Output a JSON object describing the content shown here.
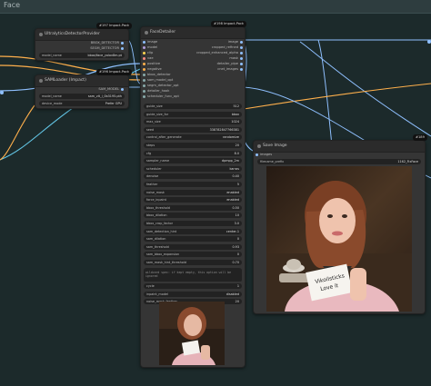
{
  "group": {
    "title": "Face"
  },
  "nodes": {
    "ultralytics": {
      "title": "UltralyticsDetectorProvider",
      "badge": "#197 Impact-Pack",
      "outputs": [
        "BBOX_DETECTOR",
        "SEGM_DETECTOR"
      ],
      "model_name_label": "model_name",
      "model_name_value": "bbox/face_yolov8m.pt"
    },
    "samloader": {
      "title": "SAMLoader (Impact)",
      "badge": "#196 Impact-Pack",
      "output": "SAM_MODEL",
      "widgets": [
        {
          "label": "model_name",
          "value": "sam_vit_l_0b3195.pth"
        },
        {
          "label": "device_mode",
          "value": "Prefer GPU"
        }
      ]
    },
    "facedetailer": {
      "title": "FaceDetailer",
      "badge": "#198 Impact-Pack",
      "inputs": [
        "image",
        "model",
        "clip",
        "vae",
        "positive",
        "negative",
        "bbox_detector",
        "sam_model_opt",
        "segm_detector_opt",
        "detailer_hook",
        "scheduler_func_opt"
      ],
      "outputs": [
        "image",
        "cropped_refined",
        "cropped_enhanced_alpha",
        "mask",
        "detailer_pipe",
        "cnet_images"
      ],
      "widgets": [
        {
          "label": "guide_size",
          "value": "512"
        },
        {
          "label": "guide_size_for",
          "value": "bbox"
        },
        {
          "label": "max_size",
          "value": "1024"
        },
        {
          "label": "seed",
          "value": "338782847766381"
        },
        {
          "label": "control_after_generate",
          "value": "randomize"
        },
        {
          "label": "steps",
          "value": "20"
        },
        {
          "label": "cfg",
          "value": "8.0"
        },
        {
          "label": "sampler_name",
          "value": "dpmpp_2m"
        },
        {
          "label": "scheduler",
          "value": "karras"
        },
        {
          "label": "denoise",
          "value": "0.40"
        },
        {
          "label": "feather",
          "value": "5"
        },
        {
          "label": "noise_mask",
          "value": "enabled"
        },
        {
          "label": "force_inpaint",
          "value": "enabled"
        },
        {
          "label": "bbox_threshold",
          "value": "0.50"
        },
        {
          "label": "bbox_dilation",
          "value": "10"
        },
        {
          "label": "bbox_crop_factor",
          "value": "3.0"
        },
        {
          "label": "sam_detection_hint",
          "value": "center-1"
        },
        {
          "label": "sam_dilation",
          "value": "0"
        },
        {
          "label": "sam_threshold",
          "value": "0.93"
        },
        {
          "label": "sam_bbox_expansion",
          "value": "0"
        },
        {
          "label": "sam_mask_hint_threshold",
          "value": "0.70"
        },
        {
          "label": "sam_mask_hint_use_negative",
          "value": "False"
        },
        {
          "label": "drop_size",
          "value": "10"
        }
      ],
      "wildcard_placeholder": "wildcard spec: if kept empty, this option will be ignored",
      "widgets2": [
        {
          "label": "cycle",
          "value": "1"
        },
        {
          "label": "inpaint_model",
          "value": "disabled"
        },
        {
          "label": "noise_mask_feather",
          "value": "20"
        }
      ]
    },
    "saveimage": {
      "title": "Save Image",
      "badge": "#189",
      "input": "images",
      "filename_label": "filename_prefix",
      "filename_value": "1162_FixFace",
      "caption_left": "Vikoilsticks",
      "caption_right": "Love it"
    }
  },
  "colors": {
    "wire_blue": "#8fc0ff",
    "wire_orange": "#ffb04c",
    "wire_cyan": "#63c6e6",
    "badge_bg": "#111111",
    "node_bg": "#353535"
  }
}
